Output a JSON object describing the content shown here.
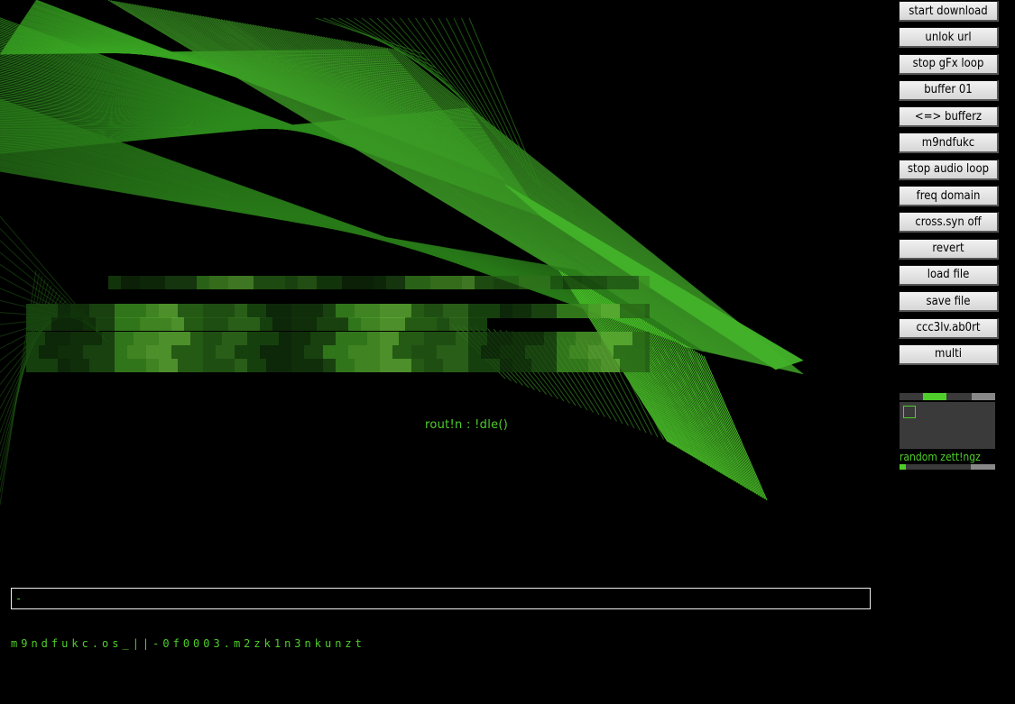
{
  "toolbar": {
    "buttons": [
      {
        "key": "start-download",
        "label": "start download"
      },
      {
        "key": "unlock-url",
        "label": "unlok url"
      },
      {
        "key": "stop-gfx-loop",
        "label": "stop gFx loop"
      },
      {
        "key": "buffer-01",
        "label": "buffer 01"
      },
      {
        "key": "swap-buffers",
        "label": "<=> bufferz"
      },
      {
        "key": "m9ndfukc",
        "label": "m9ndfukc"
      },
      {
        "key": "stop-audio-loop",
        "label": "stop audio loop"
      },
      {
        "key": "freq-domain",
        "label": "freq domain"
      },
      {
        "key": "cross-syn-off",
        "label": "cross.syn off"
      },
      {
        "key": "revert",
        "label": "revert"
      },
      {
        "key": "load-file",
        "label": "load file"
      },
      {
        "key": "save-file",
        "label": "save file"
      },
      {
        "key": "ccc3lv-abort",
        "label": "ccc3lv.ab0rt"
      },
      {
        "key": "multi",
        "label": "multi"
      }
    ]
  },
  "visualizer": {
    "status": "rout!n : !dle()"
  },
  "random_settings": {
    "label": "random zett!ngz",
    "top_slider_level": 0.25,
    "bottom_slider_level": 0.05
  },
  "command": {
    "value": "-"
  },
  "footer": {
    "text": "m9ndfukc.os_||-0f0003.m2zk1n3nkunzt"
  },
  "colors": {
    "accent": "#4fce2b",
    "background": "#000000",
    "button_face": "#e4e4e4"
  }
}
